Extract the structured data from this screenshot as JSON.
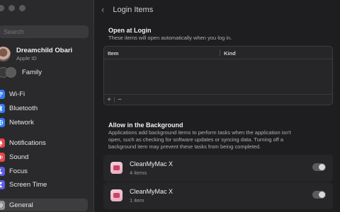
{
  "sidebar": {
    "search_placeholder": "Search",
    "account": {
      "name": "Dreamchild Obari",
      "subtitle": "Apple ID"
    },
    "family_label": "Family",
    "items": [
      {
        "label": "Wi-Fi",
        "icon": "wifi-icon",
        "color": "#2f7cf6"
      },
      {
        "label": "Bluetooth",
        "icon": "bluetooth-icon",
        "color": "#2f7cf6"
      },
      {
        "label": "Network",
        "icon": "network-icon",
        "color": "#2f7cf6"
      },
      {
        "label": "Notifications",
        "icon": "bell-icon",
        "color": "#e5484d"
      },
      {
        "label": "Sound",
        "icon": "speaker-icon",
        "color": "#e5484d"
      },
      {
        "label": "Focus",
        "icon": "moon-icon",
        "color": "#5e5ce6"
      },
      {
        "label": "Screen Time",
        "icon": "hourglass-icon",
        "color": "#5e5ce6"
      },
      {
        "label": "General",
        "icon": "gear-icon",
        "color": "#8e8e93"
      }
    ]
  },
  "header": {
    "title": "Login Items"
  },
  "open_at_login": {
    "title": "Open at Login",
    "description": "These items will open automatically when you log in.",
    "columns": [
      "Item",
      "Kind"
    ],
    "add_label": "+",
    "remove_label": "−"
  },
  "background": {
    "title": "Allow in the Background",
    "description_lines": [
      "Applications add background items to perform tasks when the application isn't",
      "open, such as checking for software updates or syncing data. Turning off a",
      "background item may prevent these tasks from being completed."
    ],
    "apps": [
      {
        "name": "CleanMyMac X",
        "count": "4 items",
        "enabled": true
      },
      {
        "name": "CleanMyMac X",
        "count": "1 item",
        "enabled": true
      }
    ]
  }
}
